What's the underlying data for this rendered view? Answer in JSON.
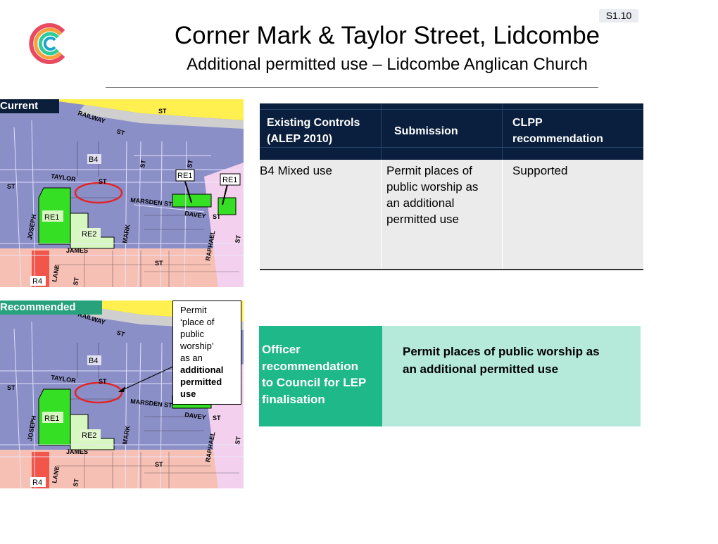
{
  "slide_number": "S1.10",
  "title": "Corner Mark & Taylor Street, Lidcombe",
  "subtitle": "Additional permitted use – Lidcombe Anglican Church",
  "logo": {
    "icon": "c-logo-icon",
    "colors": [
      "#e84a5f",
      "#f7a03c",
      "#2ecc9a",
      "#1ca5c9"
    ]
  },
  "maps": {
    "current_label": "Current",
    "recommended_label": "Recommended",
    "zones": {
      "b4": "B4",
      "re1": "RE1",
      "re2": "RE2",
      "r4": "R4"
    },
    "streets": {
      "railway": "RAILWAY",
      "st": "ST",
      "taylor": "TAYLOR",
      "marsden": "MARSDEN ST",
      "davey": "DAVEY",
      "joseph": "JOSEPH",
      "mark": "MARK",
      "james": "JAMES",
      "raphael": "RAPHAEL",
      "lane": "LANE"
    },
    "callout": {
      "line1": "Permit",
      "line2": "‘place of",
      "line3": "public",
      "line4": "worship’",
      "line5": "as an",
      "line6": "additional",
      "line7": "permitted",
      "line8": "use"
    }
  },
  "table": {
    "headers": {
      "existing_line1": "Existing Controls",
      "existing_line2": "(ALEP 2010)",
      "submission": "Submission",
      "clpp_line1": "CLPP",
      "clpp_line2": "recommendation"
    },
    "row": {
      "existing": "B4 Mixed use",
      "submission_lines": [
        "Permit places of",
        "public worship as",
        "an additional",
        "permitted use"
      ],
      "clpp": "Supported"
    }
  },
  "officer": {
    "label_lines": [
      "Officer",
      "recommendation",
      "to Council for LEP",
      "finalisation"
    ],
    "recommendation_lines": [
      "Permit places of public worship as",
      "an additional permitted use"
    ]
  },
  "colors": {
    "header_navy": "#0a1f3d",
    "officer_green": "#1fb888",
    "recommendation_mint": "#b5eadb",
    "b4_zone": "#8b8fc7",
    "re1_zone": "#35e024",
    "re2_zone": "#d7f7c1",
    "r4_zone": "#f2554a",
    "residential_pink": "#f7c0b5",
    "rail_yellow": "#ffef4f",
    "highlight_red": "#e0252a"
  }
}
